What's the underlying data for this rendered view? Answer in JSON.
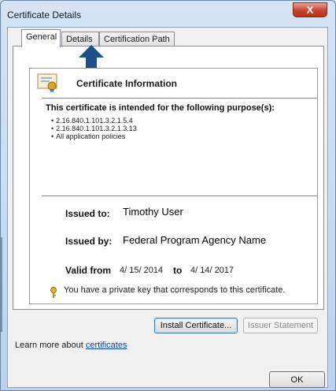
{
  "window": {
    "title": "Certificate Details",
    "close_label": "X"
  },
  "tabs": [
    {
      "label": "General",
      "active": true
    },
    {
      "label": "Details",
      "active": false
    },
    {
      "label": "Certification Path",
      "active": false
    }
  ],
  "info": {
    "heading": "Certificate Information",
    "purpose_heading": "This certificate is intended for the following purpose(s):",
    "purposes": [
      "2.16.840.1.101.3.2.1.5.4",
      "2.16.840.1.101.3.2.1.3.13",
      "All application policies"
    ],
    "issued_to_label": "Issued to:",
    "issued_to_value": "Timothy User",
    "issued_by_label": "Issued by:",
    "issued_by_value": "Federal Program Agency Name",
    "valid_from_label": "Valid from",
    "valid_from_value": "4/ 15/ 2014",
    "valid_to_label": "to",
    "valid_to_value": "4/ 14/ 2017",
    "private_key_msg": "You have a private key that corresponds to this certificate."
  },
  "buttons": {
    "install": "Install Certificate...",
    "issuer_statement": "Issuer Statement",
    "ok": "OK"
  },
  "learn_more": {
    "prefix": "Learn more about ",
    "link": "certificates"
  },
  "colors": {
    "arrow": "#1f4e8c",
    "link": "#0046d5",
    "close": "#c9442c"
  }
}
